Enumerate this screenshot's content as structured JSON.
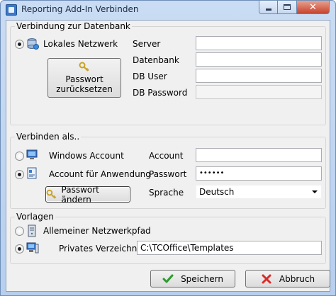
{
  "window": {
    "title": "Reporting Add-In Verbinden"
  },
  "db_group": {
    "title": "Verbindung zur Datenbank",
    "radio_label": "Lokales Netzwerk",
    "reset_button": "Passwort\nzurücksetzen",
    "server_label": "Server",
    "server_value": "",
    "database_label": "Datenbank",
    "database_value": "",
    "dbuser_label": "DB User",
    "dbuser_value": "",
    "dbpassword_label": "DB Password",
    "dbpassword_value": ""
  },
  "connect_group": {
    "title": "Verbinden als..",
    "windows_account_label": "Windows Account",
    "app_account_label": "Account für Anwendung",
    "change_password_button": "Passwort ändern",
    "account_label": "Account",
    "account_value": "",
    "password_label": "Passwort",
    "password_value": "••••••",
    "language_label": "Sprache",
    "language_value": "Deutsch"
  },
  "templates_group": {
    "title": "Vorlagen",
    "network_path_label": "Allemeiner Netzwerkpfad",
    "private_dir_label": "Privates Verzeichnis",
    "private_dir_value": "C:\\TCOffice\\Templates"
  },
  "footer": {
    "save_button": "Speichern",
    "cancel_button": "Abbruch"
  },
  "colors": {
    "save_check": "#2e9a2e",
    "cancel_x": "#d92b2b",
    "title_close": "#c7432c"
  }
}
